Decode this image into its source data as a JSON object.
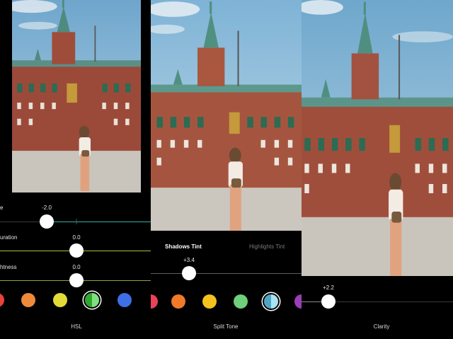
{
  "panels": {
    "hsl": {
      "tool_label": "HSL",
      "sliders": [
        {
          "label": "e",
          "value": "-2.0",
          "level": -0.2,
          "color": "#2fb3a6"
        },
        {
          "label": "uration",
          "value": "0.0",
          "level": 0.0,
          "color": "#a8c23a"
        },
        {
          "label": "htness",
          "value": "0.0",
          "level": 0.0,
          "color": "#9aa23a"
        }
      ],
      "swatches": [
        {
          "color": "#e8423a",
          "name": "red"
        },
        {
          "color": "#ef8a3a",
          "name": "orange"
        },
        {
          "color": "#e3da39",
          "name": "yellow"
        },
        {
          "color": "#3fbf3f",
          "name": "green",
          "selected": true
        },
        {
          "color": "#3f6fe6",
          "name": "blue"
        }
      ]
    },
    "split_tone": {
      "tool_label": "Split Tone",
      "tabs": {
        "active": "Shadows Tint",
        "inactive": "Highlights Tint"
      },
      "slider": {
        "value": "+3.4",
        "level": 0.34
      },
      "swatches": [
        {
          "color": "#e8425a",
          "name": "pink"
        },
        {
          "color": "#f07a2a",
          "name": "orange"
        },
        {
          "color": "#f4c21f",
          "name": "yellow"
        },
        {
          "color": "#6fcf7a",
          "name": "green"
        },
        {
          "color": "#6fc3e2",
          "name": "cyan",
          "selected": true
        },
        {
          "color": "#9a3fb5",
          "name": "purple"
        }
      ]
    },
    "clarity": {
      "tool_label": "Clarity",
      "slider": {
        "value": "+2.2",
        "level": 0.22
      }
    }
  },
  "colors": {
    "accent": "#ffffff",
    "background": "#000000",
    "track": "#3a3a3a"
  }
}
